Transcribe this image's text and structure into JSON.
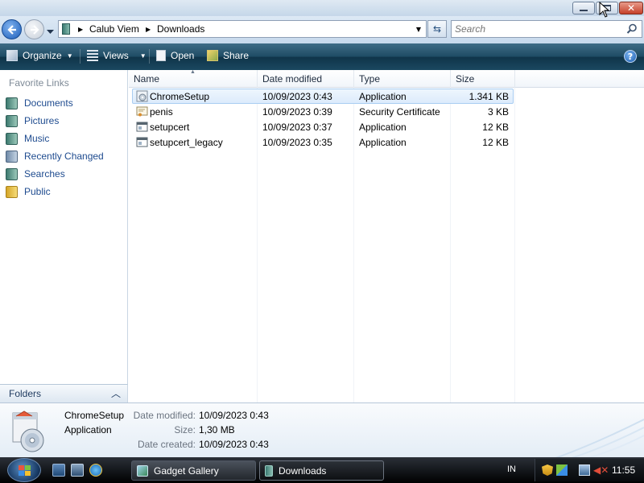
{
  "window": {
    "buttons": {
      "minimize": "Minimize",
      "maximize": "Maximize",
      "close": "Close"
    }
  },
  "address": {
    "crumbs": [
      "Calub Viem",
      "Downloads"
    ],
    "search_placeholder": "Search"
  },
  "toolbar": {
    "organize": "Organize",
    "views": "Views",
    "open": "Open",
    "share": "Share",
    "help": "?"
  },
  "nav": {
    "header": "Favorite Links",
    "links": [
      {
        "label": "Documents",
        "icon": "documents-icon"
      },
      {
        "label": "Pictures",
        "icon": "pictures-icon"
      },
      {
        "label": "Music",
        "icon": "music-icon"
      },
      {
        "label": "Recently Changed",
        "icon": "recent-icon"
      },
      {
        "label": "Searches",
        "icon": "searches-icon"
      },
      {
        "label": "Public",
        "icon": "public-folder-icon"
      }
    ],
    "folders": "Folders"
  },
  "files": {
    "columns": [
      "Name",
      "Date modified",
      "Type",
      "Size"
    ],
    "rows": [
      {
        "name": "ChromeSetup",
        "date": "10/09/2023 0:43",
        "type": "Application",
        "size": "1.341 KB",
        "selected": true
      },
      {
        "name": "penis",
        "date": "10/09/2023 0:39",
        "type": "Security Certificate",
        "size": "3 KB",
        "selected": false
      },
      {
        "name": "setupcert",
        "date": "10/09/2023 0:37",
        "type": "Application",
        "size": "12 KB",
        "selected": false
      },
      {
        "name": "setupcert_legacy",
        "date": "10/09/2023 0:35",
        "type": "Application",
        "size": "12 KB",
        "selected": false
      }
    ]
  },
  "details": {
    "name": "ChromeSetup",
    "type": "Application",
    "date_modified_label": "Date modified:",
    "date_modified": "10/09/2023 0:43",
    "size_label": "Size:",
    "size": "1,30 MB",
    "date_created_label": "Date created:",
    "date_created": "10/09/2023 0:43"
  },
  "taskbar": {
    "buttons": [
      "Gadget Gallery",
      "Downloads"
    ],
    "language": "IN",
    "clock": "11:55"
  },
  "colors": {
    "toolbar": "#1e4b64",
    "link": "#1e4b8f",
    "selection": "#dcebfc",
    "close_button": "#c5402a"
  }
}
